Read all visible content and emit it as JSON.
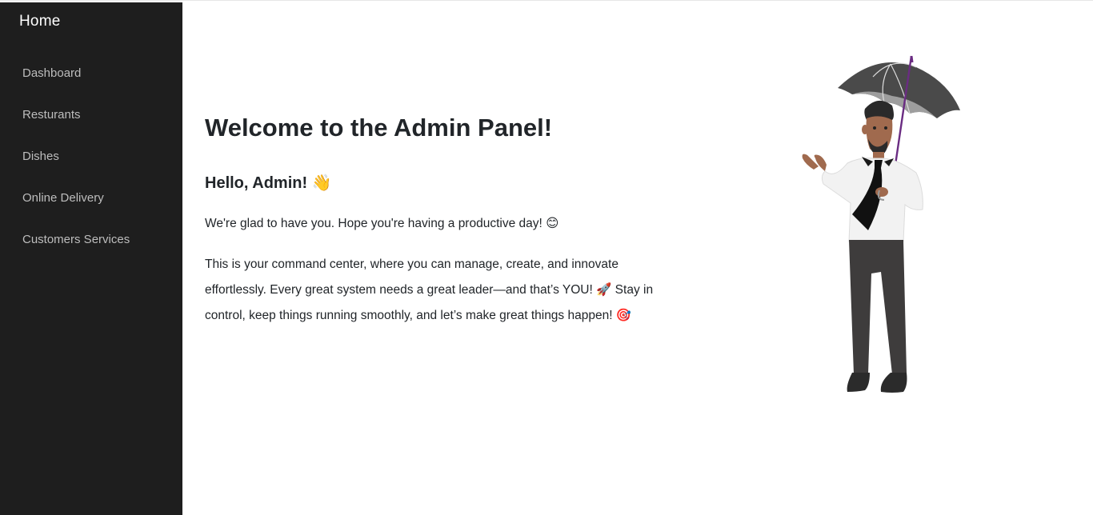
{
  "sidebar": {
    "brand": "Home",
    "items": [
      {
        "label": "Dashboard"
      },
      {
        "label": "Resturants"
      },
      {
        "label": "Dishes"
      },
      {
        "label": "Online Delivery"
      },
      {
        "label": "Customers Services"
      }
    ]
  },
  "main": {
    "title": "Welcome to the Admin Panel!",
    "greeting": "Hello, Admin! 👋",
    "intro": "We're glad to have you. Hope you're having a productive day! 😊",
    "body": "This is your command center, where you can manage, create, and innovate effortlessly. Every great system needs a great leader—and that’s YOU! 🚀 Stay in control, keep things running smoothly, and let’s make great things happen! 🎯"
  },
  "illustration": {
    "icon": "man-with-umbrella-icon"
  },
  "colors": {
    "sidebar_bg": "#1e1e1e",
    "sidebar_text": "#bdbdbd",
    "brand_text": "#ffffff",
    "heading_text": "#212529"
  }
}
